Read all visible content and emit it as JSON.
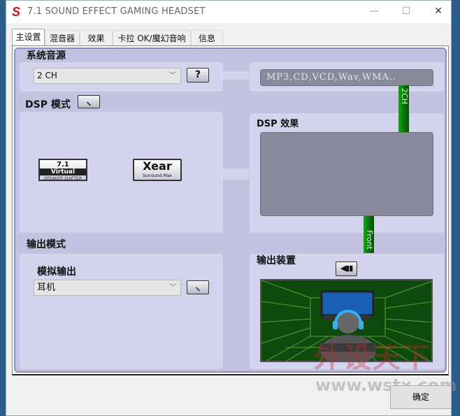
{
  "window": {
    "title": "7.1 SOUND EFFECT GAMING HEADSET",
    "app_icon": "S",
    "minimize": "—",
    "maximize": "☐",
    "close": "✕"
  },
  "tabs": [
    {
      "label": "主设置",
      "selected": true
    },
    {
      "label": "混音器"
    },
    {
      "label": "效果"
    },
    {
      "label": "卡拉 OK/魔幻音响"
    },
    {
      "label": "信息"
    }
  ],
  "source": {
    "heading": "系统音源",
    "select_value": "2 CH",
    "help_label": "?",
    "formats": "MP3,CD,VCD,Wav,WMA..",
    "channel_tag": "2CH"
  },
  "dsp_mode": {
    "heading": "DSP 模式",
    "logo1": {
      "line1": "7.1",
      "line2": "Virtual",
      "line3": "SPEAKER SHIFTER"
    },
    "logo2": {
      "line1": "Xear",
      "line2": "Surround Max"
    }
  },
  "dsp_effect": {
    "heading": "DSP 效果",
    "front_tag": "Front"
  },
  "output_mode": {
    "heading": "输出模式",
    "sub_heading": "模拟输出",
    "select_value": "耳机"
  },
  "output_device": {
    "heading": "输出装置"
  },
  "footer": {
    "ok_label": "确定"
  },
  "watermark": {
    "text": "外设天下",
    "url": "www.wstx.com"
  },
  "colors": {
    "panel": "#c3c3e1",
    "box": "#d3d3ed",
    "channel": "#0b8a0b",
    "field": "#8a8a9c"
  }
}
